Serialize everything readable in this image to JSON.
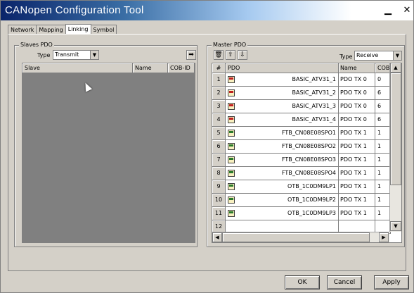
{
  "window": {
    "title": "CANopen Configuration Tool",
    "min_glyph": "▁",
    "close_glyph": "✕"
  },
  "tabs": [
    "Network",
    "Mapping",
    "Linking",
    "Symbol"
  ],
  "active_tab": "Linking",
  "slave_pdo": {
    "legend": "Slaves PDO",
    "type_label": "Type",
    "type_value": "Transmit",
    "columns": [
      "Slave",
      "Name",
      "COB-ID"
    ]
  },
  "master_pdo": {
    "legend": "Master PDO",
    "type_label": "Type",
    "type_value": "Receive",
    "columns": [
      "#",
      "PDO",
      "Name",
      "COB"
    ],
    "rows": [
      {
        "num": "1",
        "pdo": "BASIC_ATV31_1",
        "name": "PDO TX 0",
        "cob": "0",
        "icon": "red"
      },
      {
        "num": "2",
        "pdo": "BASIC_ATV31_2",
        "name": "PDO TX 0",
        "cob": "6",
        "icon": "red"
      },
      {
        "num": "3",
        "pdo": "BASIC_ATV31_3",
        "name": "PDO TX 0",
        "cob": "6",
        "icon": "red"
      },
      {
        "num": "4",
        "pdo": "BASIC_ATV31_4",
        "name": "PDO TX 0",
        "cob": "6",
        "icon": "red"
      },
      {
        "num": "5",
        "pdo": "FTB_CN08E08SPO1",
        "name": "PDO TX 1",
        "cob": "1",
        "icon": "grn"
      },
      {
        "num": "6",
        "pdo": "FTB_CN08E08SPO2",
        "name": "PDO TX 1",
        "cob": "1",
        "icon": "grn"
      },
      {
        "num": "7",
        "pdo": "FTB_CN08E08SPO3",
        "name": "PDO TX 1",
        "cob": "1",
        "icon": "grn"
      },
      {
        "num": "8",
        "pdo": "FTB_CN08E08SPO4",
        "name": "PDO TX 1",
        "cob": "1",
        "icon": "grn"
      },
      {
        "num": "9",
        "pdo": "OTB_1C0DM9LP1",
        "name": "PDO TX 1",
        "cob": "1",
        "icon": "grn"
      },
      {
        "num": "10",
        "pdo": "OTB_1C0DM9LP2",
        "name": "PDO TX 1",
        "cob": "1",
        "icon": "grn"
      },
      {
        "num": "11",
        "pdo": "OTB_1C0DM9LP3",
        "name": "PDO TX 1",
        "cob": "1",
        "icon": "grn"
      },
      {
        "num": "12",
        "pdo": "",
        "name": "",
        "cob": "",
        "icon": ""
      }
    ]
  },
  "buttons": {
    "ok": "OK",
    "cancel": "Cancel",
    "apply": "Apply"
  }
}
